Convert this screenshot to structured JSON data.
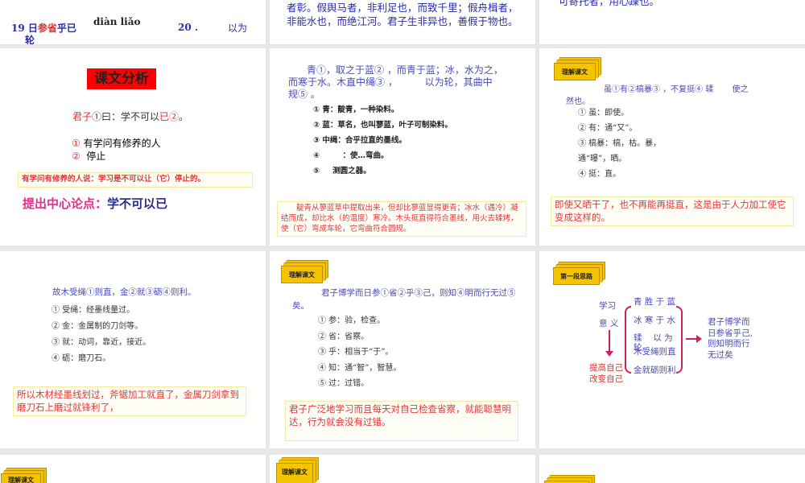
{
  "slides": [
    {
      "line1_a": "19 日",
      "line1_b": "参省",
      "line1_c": "乎已",
      "line2": "轮",
      "pinyin": "diàn  liǎo",
      "num": "20 .",
      "word": "以为"
    },
    {
      "line1": "者彰。假舆马者，非利足也，而致千里；假舟楫者，",
      "line2": "非能水也，而绝江河。君子生非异也，善假于物也。"
    },
    {
      "line1": "可寄托者，用心躁也。"
    },
    {
      "title": "课文分析",
      "quote_a": "君子",
      "quote_b": "①曰：学不可以",
      "quote_c": "已②",
      "quote_d": "。",
      "item1_n": "①",
      "item1": "有学问有修养的人",
      "item2_n": "②",
      "item2": "停止",
      "note": "有学问有修养的人说：学习是不可以让（它）停止的。",
      "thesis_label": "提出中心论点：",
      "thesis": "学不可以已"
    },
    {
      "text1": "青①，取之于蓝② ，而青于蓝；冰，水为之，",
      "text2": "而寒于水。木直中绳③ ，　　　 以为轮，其曲中",
      "text3": "规⑤ 。",
      "rou": "𫐓",
      "items": [
        "① 青：靛青，一种染料。",
        "② 蓝：草名，也叫蓼蓝，叶子可制染料。",
        "③ 中绳：合乎拉直的墨线。",
        "④　　　：使…弯曲。",
        "⑤ 　 测圆之器。"
      ],
      "note": "靛青从蓼蓝草中提取出来，但却比蓼蓝显得更青；冰水（遇冷）凝结而成，却比水（的温度）寒冷。木头挺直得符合墨线，用火去𫐓烤，使（它）弯成车轮，它弯曲符合圆规。"
    },
    {
      "tag": "理解课文",
      "text1": "虽①有②槁暴③ ，不复挺④ 𫐓　　 使之",
      "text2": "然也。",
      "items": [
        "①  虽：即使。",
        "② 有：通“又”。",
        "③ 槁暴：槁，枯。暴，",
        "通“曝”，晒。",
        "④ 挺：直。"
      ],
      "note": "即使又晒干了，也不再能再挺直，这是由于人力加工使它变成这样的。"
    },
    {
      "text": "故木受绳①则直，金②就③砺④则利。",
      "items": [
        "① 受绳：经墨线量过。",
        "② 金：金属制的刀剑等。",
        "③ 就：动词，靠近，接近。",
        "④ 砺：磨刀石。"
      ],
      "note": "所以木材经墨线划过，斧锯加工就直了，金属刀剑拿到磨刀石上磨过就锋利了，"
    },
    {
      "tag": "理解课文",
      "text1": "君子博学而日参①省②乎③己，则知④明而行无过⑤",
      "text2": "矣。",
      "items": [
        "① 参：验，检查。",
        "② 省：省察。",
        "③ 乎：相当于“于”。",
        "④ 知：通“智”，智慧。",
        "⑤ 过：过错。"
      ],
      "note": "君子广泛地学习而且每天对自己检查省察，就能聪慧明达，行为就会没有过错。"
    },
    {
      "tag": "第一段思路",
      "left1": "学习",
      "left2": "意 义",
      "bottom1": "提高自己",
      "bottom2": "改变自己",
      "mid": [
        "青 胜 于 蓝",
        "冰 寒 于 水",
        "𫐓　 以 为",
        "轮",
        "木受绳则直",
        "金就砺则利"
      ],
      "right": [
        "君子博学而",
        "日参省乎己,",
        "则知明而行",
        "无过矣"
      ]
    },
    {
      "tag": "理解课文"
    },
    {
      "tag": "理解课文"
    },
    {
      "tag": ""
    }
  ]
}
